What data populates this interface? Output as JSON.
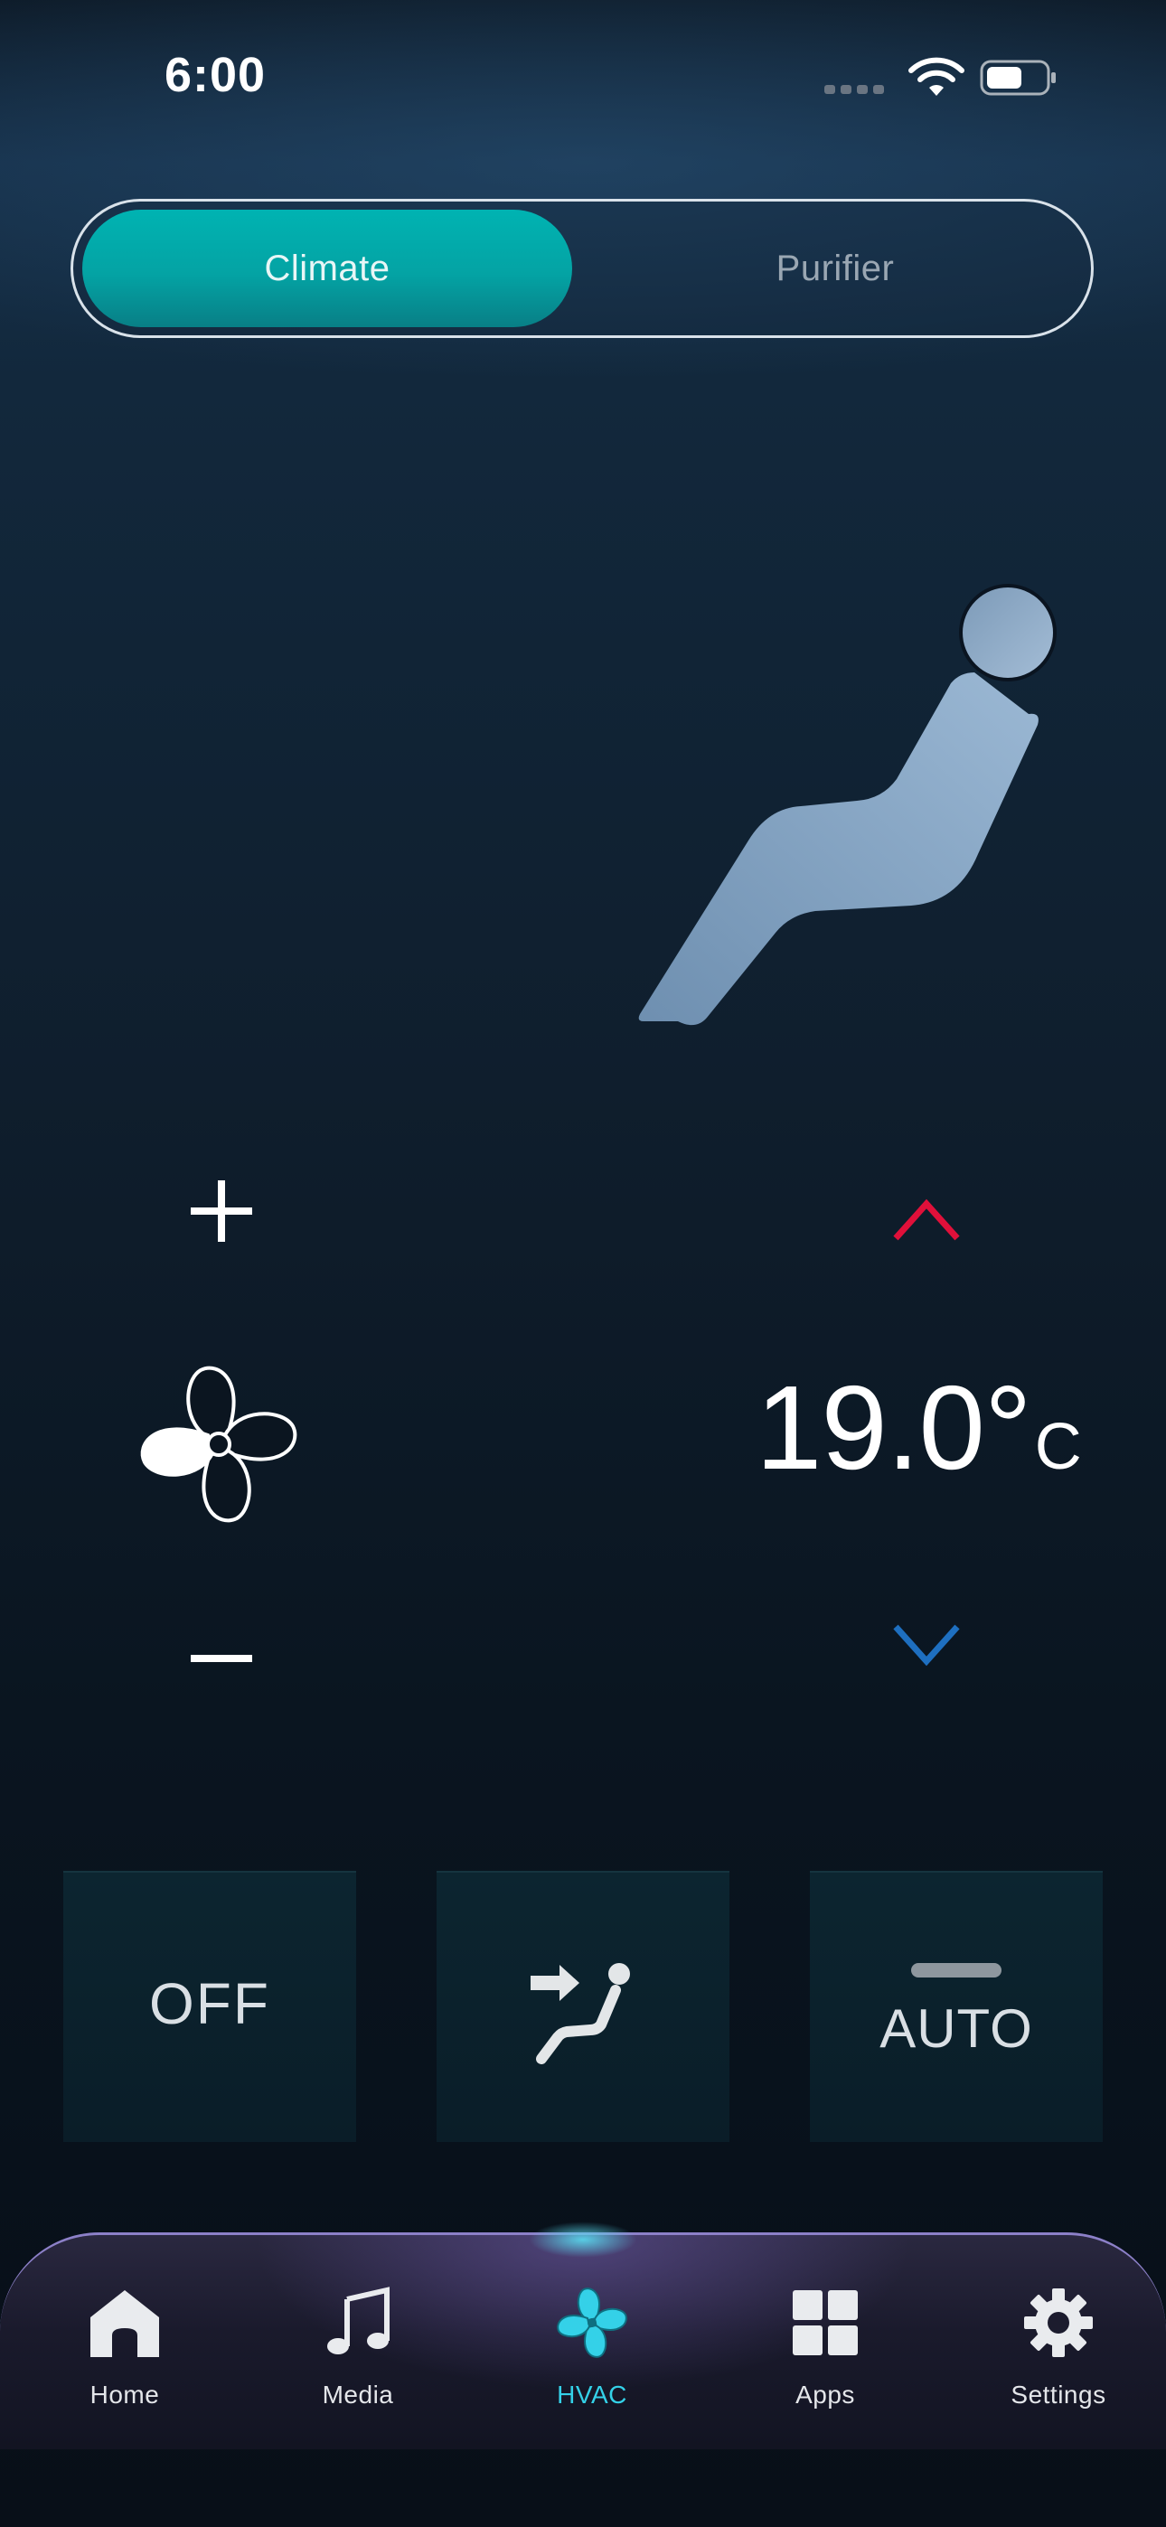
{
  "status_bar": {
    "time": "6:00",
    "icons": [
      "cellular-signal-icon",
      "wifi-icon",
      "battery-icon"
    ]
  },
  "mode_toggle": {
    "options": [
      {
        "label": "Climate",
        "selected": true
      },
      {
        "label": "Purifier",
        "selected": false
      }
    ]
  },
  "climate": {
    "temperature": "19.0°",
    "unit": "C",
    "fan_speed_controls": {
      "increase_icon": "plus-icon",
      "decrease_icon": "minus-icon",
      "fan_icon": "fan-icon"
    },
    "temperature_controls": {
      "increase_icon": "chevron-up-icon",
      "decrease_icon": "chevron-down-icon"
    },
    "illustration": {
      "airflow": "airflow-lines",
      "seat": "seat-occupant-icon"
    }
  },
  "action_buttons": [
    {
      "label": "OFF"
    },
    {
      "icon": "airflow-to-body-icon"
    },
    {
      "label": "AUTO"
    }
  ],
  "bottom_nav": {
    "items": [
      {
        "label": "Home",
        "icon": "home-icon",
        "active": false
      },
      {
        "label": "Media",
        "icon": "music-note-icon",
        "active": false
      },
      {
        "label": "HVAC",
        "icon": "fan-icon",
        "active": true
      },
      {
        "label": "Apps",
        "icon": "apps-grid-icon",
        "active": false
      },
      {
        "label": "Settings",
        "icon": "gear-icon",
        "active": false
      }
    ]
  },
  "colors": {
    "accent_teal": "#00b3b2",
    "temp_up_red": "#e0103a",
    "temp_down_blue": "#1e6fc0",
    "nav_active_cyan": "#34d1e8",
    "seat_blue": "#7f9fbe"
  }
}
